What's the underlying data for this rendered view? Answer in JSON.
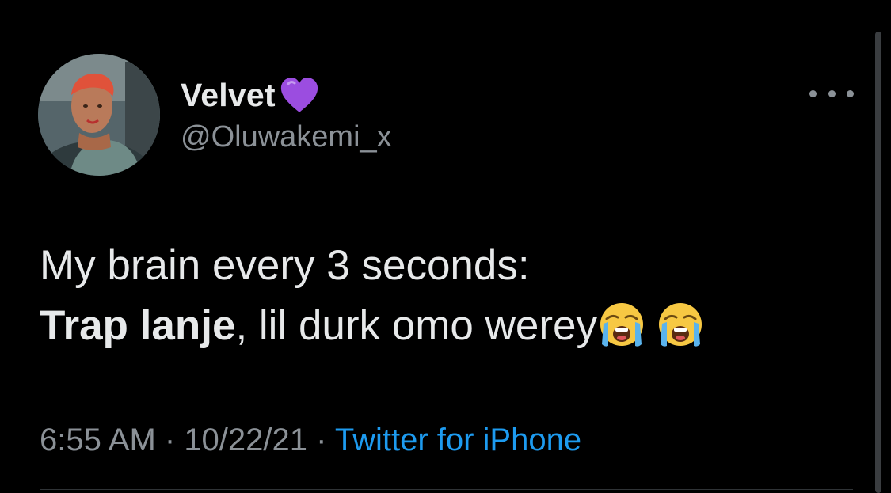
{
  "author": {
    "display_name": "Velvet",
    "badge_emoji": "purple-heart",
    "handle": "@Oluwakemi_x",
    "avatar": "profile-photo"
  },
  "tweet": {
    "line1": "My brain every 3 seconds:",
    "line2_bold": "Trap lanje",
    "line2_rest": ", lil durk omo werey",
    "emojis": [
      "loudly-crying-face",
      "loudly-crying-face"
    ]
  },
  "meta": {
    "time": "6:55 AM",
    "separator": " · ",
    "date": "10/22/21",
    "source": "Twitter for iPhone"
  },
  "colors": {
    "background": "#000000",
    "primary_text": "#e7e9ea",
    "secondary_text": "#8b9197",
    "link": "#1d9bf0",
    "heart": "#9b4de0"
  },
  "icons": {
    "more": "more-options-icon"
  }
}
